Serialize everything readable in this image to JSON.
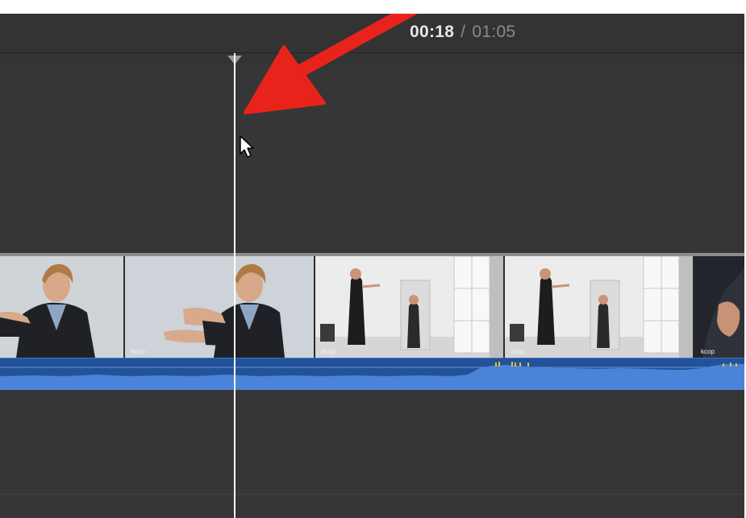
{
  "viewer": {
    "current_time": "00:18",
    "separator": "/",
    "total_time": "01:05"
  },
  "timeline": {
    "clips": [
      {
        "scene": "woman-closeup",
        "watermark": ""
      },
      {
        "scene": "woman-closeup",
        "watermark": "kcop"
      },
      {
        "scene": "room-standing",
        "watermark": "kcop"
      },
      {
        "scene": "room-standing",
        "watermark": "kcop"
      },
      {
        "scene": "dark-closeup",
        "watermark": "kcop"
      }
    ]
  },
  "annotation": {
    "arrow_color": "#e8231b"
  },
  "colors": {
    "background": "#363636",
    "audio_track": "#2a5fae",
    "audio_wave": "#4a84d8",
    "playhead": "#ffffff"
  }
}
